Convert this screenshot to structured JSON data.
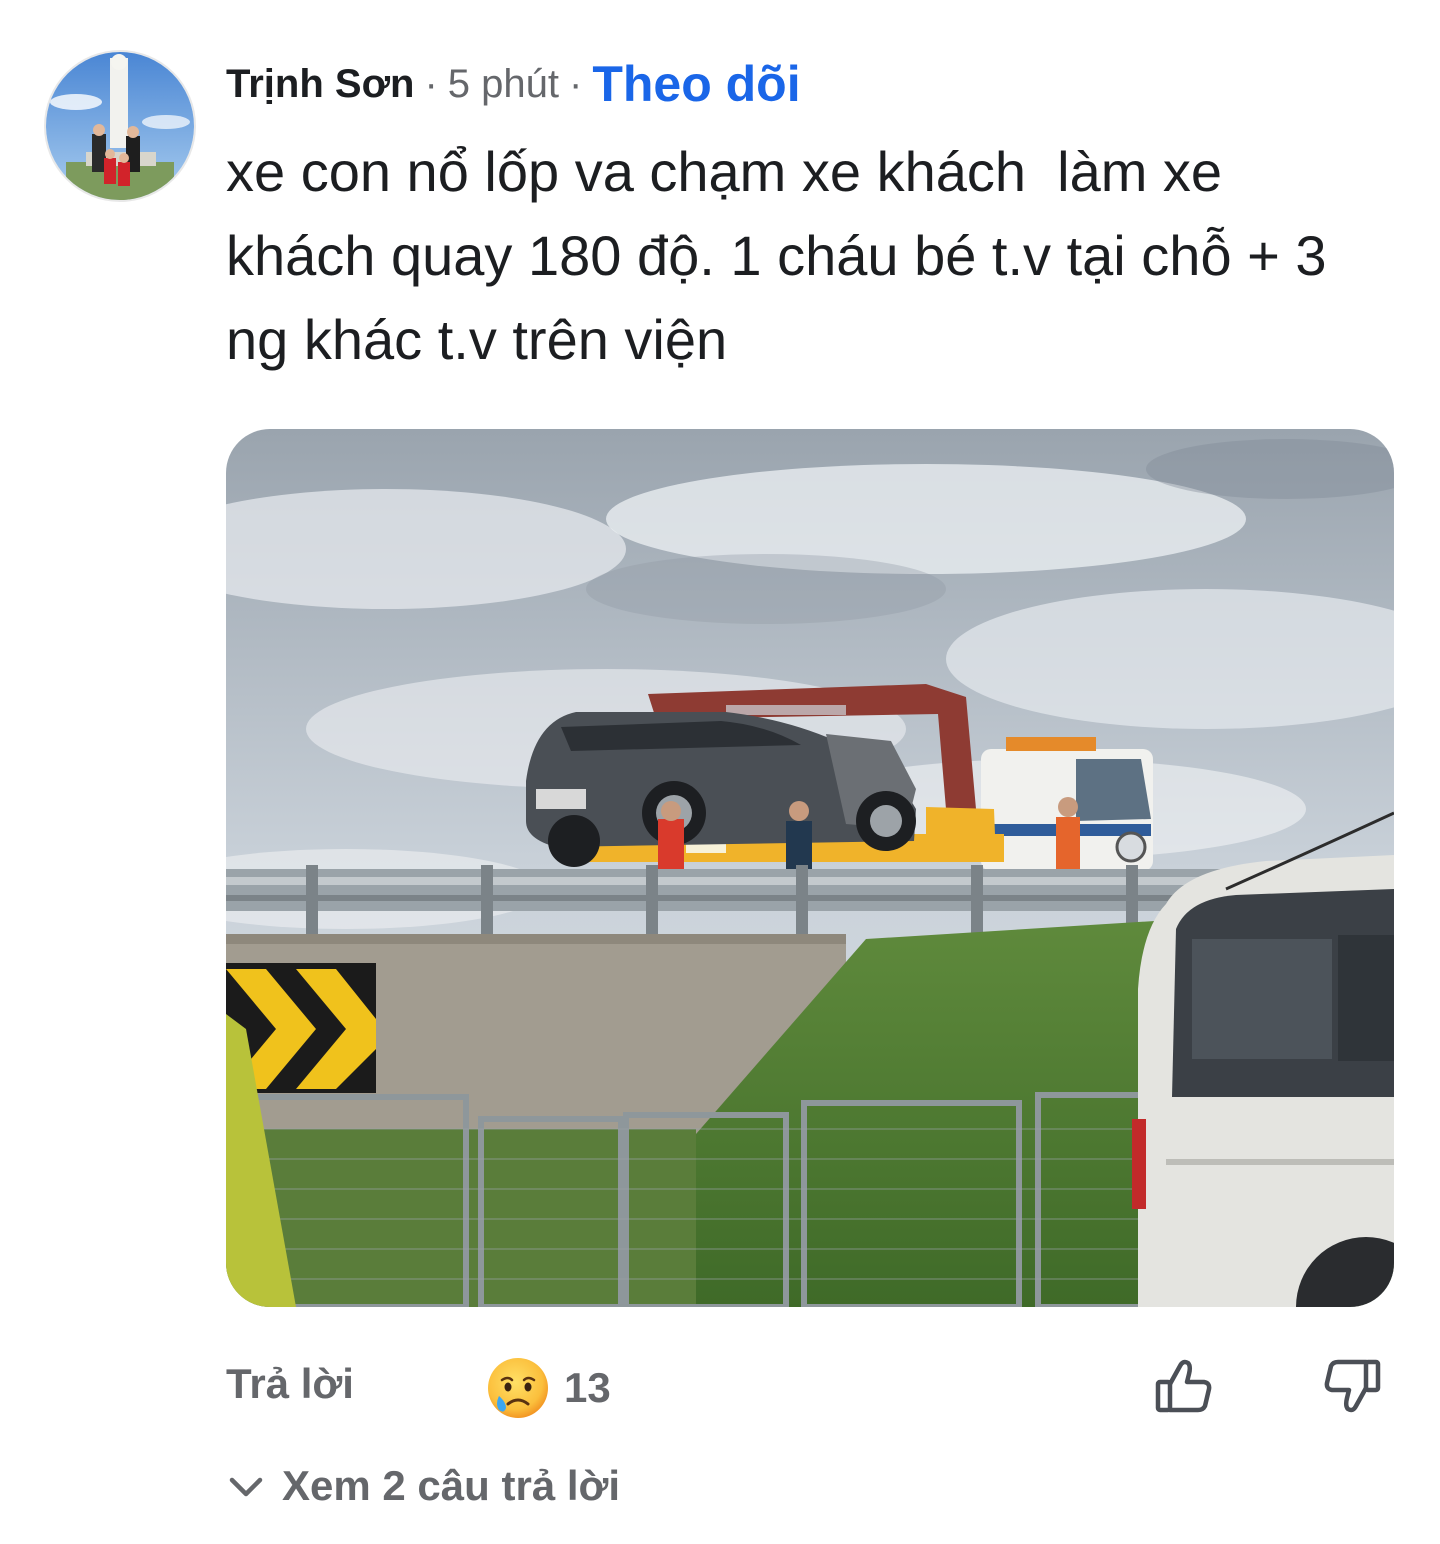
{
  "comment": {
    "author": "Trịnh Sơn",
    "separator": "·",
    "time": "5 phút",
    "follow_label": "Theo dõi",
    "text": "xe con nổ lốp va chạm xe khách  làm xe\nkhách quay 180 độ. 1 cháu bé t.v tại chỗ + 3\nng khác t.v trên viện"
  },
  "actions": {
    "reply_label": "Trả lời",
    "reaction_emoji": "crying-face-icon",
    "reaction_count": "13",
    "like_icon": "thumbs-up-icon",
    "dislike_icon": "thumbs-down-icon"
  },
  "replies": {
    "view_label": "Xem 2 câu trả lời",
    "icon": "chevron-down-icon"
  },
  "colors": {
    "follow": "#1a66e8",
    "muted": "#65676b",
    "text": "#1c1e21"
  }
}
